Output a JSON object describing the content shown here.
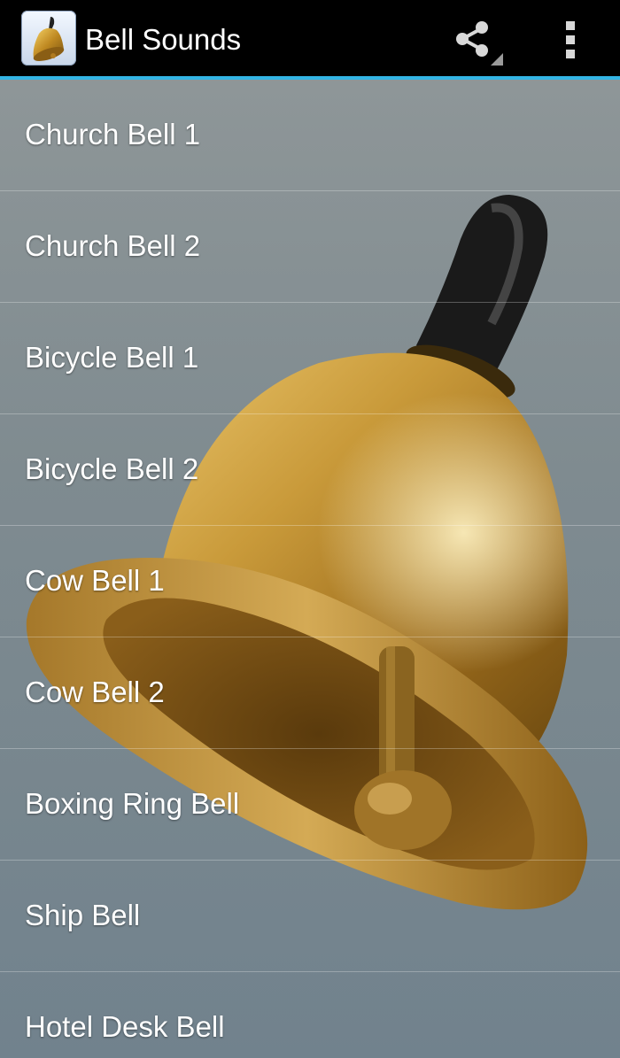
{
  "actionbar": {
    "title": "Bell Sounds",
    "app_icon": "bell-icon",
    "share_icon": "share-icon",
    "overflow_icon": "overflow-menu-icon",
    "accent_color": "#33b5e5"
  },
  "background": {
    "image": "golden-hand-bell"
  },
  "list": {
    "items": [
      {
        "label": "Church Bell 1"
      },
      {
        "label": "Church Bell 2"
      },
      {
        "label": "Bicycle Bell 1"
      },
      {
        "label": "Bicycle Bell 2"
      },
      {
        "label": "Cow Bell 1"
      },
      {
        "label": "Cow Bell 2"
      },
      {
        "label": "Boxing Ring Bell"
      },
      {
        "label": "Ship Bell"
      },
      {
        "label": "Hotel Desk Bell"
      }
    ]
  }
}
